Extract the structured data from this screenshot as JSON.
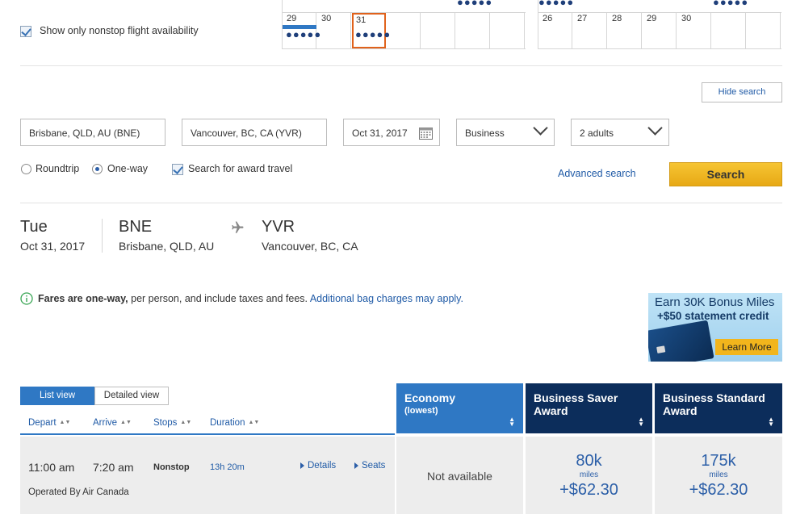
{
  "nonstop_filter": {
    "label": "Show only nonstop flight availability"
  },
  "calendar_left": {
    "days": [
      "29",
      "30",
      "31"
    ],
    "selected": "31"
  },
  "calendar_right": {
    "days": [
      "26",
      "27",
      "28",
      "29",
      "30"
    ]
  },
  "dots": "●●●●●",
  "hide_search": "Hide search",
  "search": {
    "origin": "Brisbane, QLD, AU (BNE)",
    "destination": "Vancouver, BC, CA (YVR)",
    "date": "Oct 31, 2017",
    "cabin": "Business",
    "passengers": "2 adults",
    "roundtrip": "Roundtrip",
    "oneway": "One-way",
    "award": "Search for award travel",
    "advanced": "Advanced search",
    "button": "Search"
  },
  "summary": {
    "day": "Tue",
    "date": "Oct 31, 2017",
    "from_code": "BNE",
    "from_city": "Brisbane, QLD, AU",
    "to_code": "YVR",
    "to_city": "Vancouver, BC, CA"
  },
  "fares_note": {
    "bold": "Fares are one-way,",
    "rest": " per person, and include taxes and fees.",
    "link": "Additional bag charges may apply."
  },
  "ad": {
    "line1": "Earn 30K Bonus Miles",
    "line2": "+$50 statement credit",
    "cta": "Learn More"
  },
  "views": {
    "list": "List view",
    "detailed": "Detailed view"
  },
  "sort_headers": [
    "Depart",
    "Arrive",
    "Stops",
    "Duration"
  ],
  "fare_columns": [
    {
      "title": "Economy",
      "sub": "(lowest)",
      "color": "#2f78c4"
    },
    {
      "title": "Business Saver Award",
      "sub": "",
      "color": "#0c2d5b"
    },
    {
      "title": "Business Standard Award",
      "sub": "",
      "color": "#0c2d5b"
    }
  ],
  "flight": {
    "depart": "11:00 am",
    "arrive": "7:20 am",
    "stops": "Nonstop",
    "duration": "13h 20m",
    "details": "Details",
    "seats": "Seats",
    "operated": "Operated By Air Canada",
    "economy": "Not available",
    "saver_miles": "80k",
    "saver_unit": "miles",
    "saver_tax": "+$62.30",
    "standard_miles": "175k",
    "standard_unit": "miles",
    "standard_tax": "+$62.30"
  }
}
